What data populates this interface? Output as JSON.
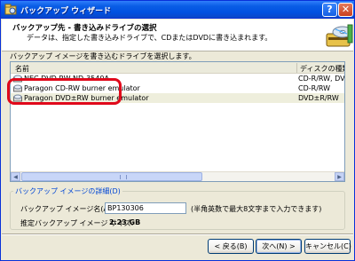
{
  "window": {
    "title": "バックアップ ウィザード",
    "help_label": "?",
    "close_label": "✕"
  },
  "header": {
    "title": "バックアップ先 - 書き込みドライブの選択",
    "subtitle": "データは、指定した書き込みドライブで、CDまたはDVDに書き込まれます。"
  },
  "instruction": "バックアップ イメージを書き込むドライブを選択します。",
  "drive_list": {
    "columns": [
      "名前",
      "ディスクの種類"
    ],
    "rows": [
      {
        "name": "NEC   DVD RW ND-3540A",
        "type": "CD-R/RW, DVD",
        "icon": "optical-drive-icon"
      },
      {
        "name": "Paragon CD-RW burner emulator",
        "type": "CD-R/RW",
        "icon": "optical-drive-icon"
      },
      {
        "name": "Paragon DVD±RW burner emulator",
        "type": "DVD±R/RW",
        "icon": "optical-drive-icon",
        "selected": true
      }
    ],
    "scroll_left": "◀",
    "scroll_right": "▶"
  },
  "details": {
    "legend": "バックアップ イメージの詳細(D)",
    "name_label": "バックアップ イメージ名(A)",
    "name_value": "BP130306",
    "hint": "(半角英数で最大8文字まで入力できます)",
    "size_label": "推定バックアップ イメージ サイズ:",
    "size_value": "2.23 GB"
  },
  "buttons": {
    "back": "< 戻る(B)",
    "next": "次へ(N) >",
    "cancel": "キャンセル(C)"
  },
  "colors": {
    "titlebar": "#0a5ee6",
    "highlight": "#e0091b",
    "legend_text": "#0046d5"
  }
}
